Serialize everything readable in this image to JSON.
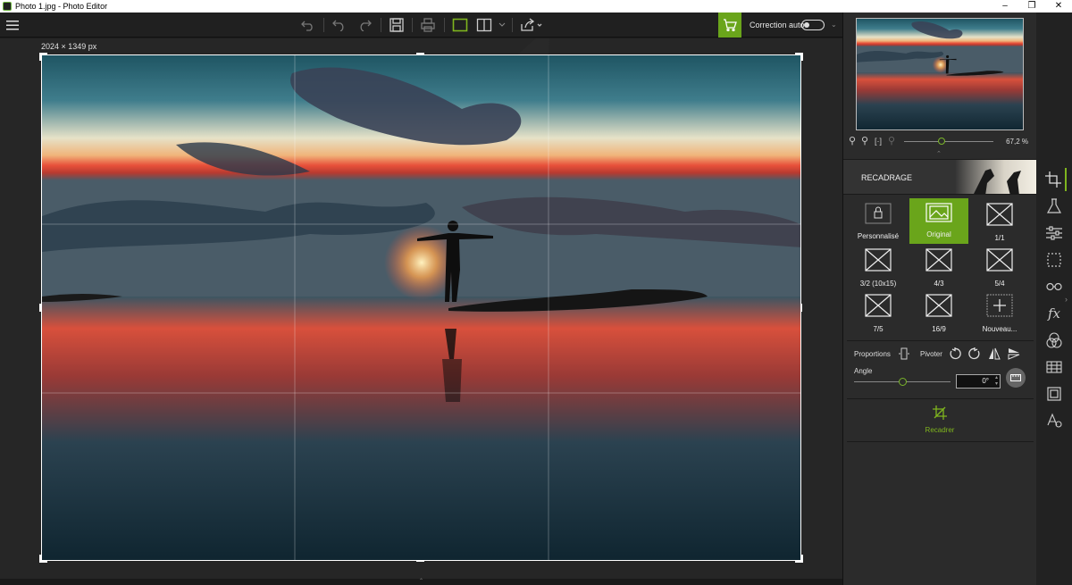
{
  "window": {
    "title": "Photo 1.jpg - Photo Editor",
    "controls": [
      "–",
      "❐",
      "✕"
    ]
  },
  "toolbar": {
    "icons": [
      "menu-icon",
      "undo-history-icon",
      "undo-icon",
      "redo-icon",
      "save-icon",
      "print-icon",
      "single-view-icon",
      "split-view-icon",
      "share-icon",
      "cart-icon"
    ],
    "auto_correct_label": "Correction auto",
    "auto_correct_on": false
  },
  "canvas": {
    "image_size": "2024 × 1349 px"
  },
  "navigator": {
    "zoom_value": "67,2 %",
    "zoom_level": 0.42
  },
  "crop_panel": {
    "title": "RECADRAGE",
    "ratios": [
      {
        "label": "Personnalisé",
        "icon": "lock-icon"
      },
      {
        "label": "Original",
        "icon": "original-icon",
        "selected": true
      },
      {
        "label": "1/1",
        "icon": "ratio-icon"
      },
      {
        "label": "3/2 (10x15)",
        "icon": "ratio-icon"
      },
      {
        "label": "4/3",
        "icon": "ratio-icon"
      },
      {
        "label": "5/4",
        "icon": "ratio-icon"
      },
      {
        "label": "7/5",
        "icon": "ratio-icon"
      },
      {
        "label": "16/9",
        "icon": "ratio-icon"
      },
      {
        "label": "Nouveau...",
        "icon": "plus-icon"
      }
    ],
    "proportions_label": "Proportions",
    "rotate_label": "Pivoter",
    "angle_label": "Angle",
    "angle_value": "0°",
    "apply_label": "Recadrer"
  },
  "colors": {
    "accent": "#6aa51b",
    "panel": "#2b2b2b",
    "canvas": "#262626"
  },
  "tools": [
    "crop-icon",
    "flask-icon",
    "sliders-icon",
    "selection-icon",
    "glasses-icon",
    "fx-icon",
    "color-circles-icon",
    "texture-icon",
    "frame-icon",
    "text-icon"
  ]
}
